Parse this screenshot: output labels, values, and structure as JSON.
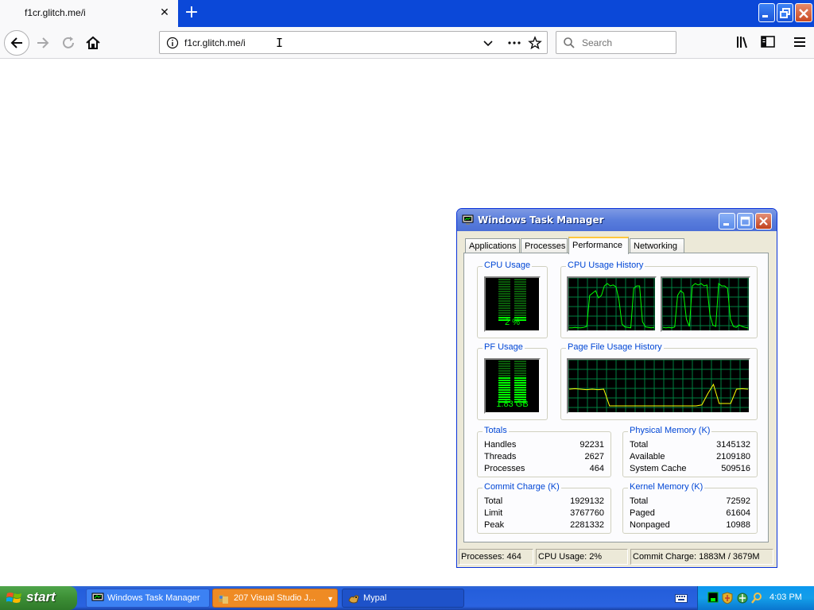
{
  "browser": {
    "tab_title": "f1cr.glitch.me/i",
    "url": "f1cr.glitch.me/i",
    "search_placeholder": "Search"
  },
  "task_manager": {
    "title": "Windows Task Manager",
    "tabs": [
      {
        "label": "Applications",
        "active": false
      },
      {
        "label": "Processes",
        "active": false
      },
      {
        "label": "Performance",
        "active": true
      },
      {
        "label": "Networking",
        "active": false
      }
    ],
    "groups": {
      "cpu_usage": "CPU Usage",
      "cpu_history": "CPU Usage History",
      "pf_usage": "PF Usage",
      "pf_history": "Page File Usage History",
      "totals": "Totals",
      "physical": "Physical Memory (K)",
      "commit": "Commit Charge (K)",
      "kernel": "Kernel Memory (K)"
    },
    "cpu_usage_value": "2 %",
    "pf_usage_value": "1.83 GB",
    "cpu_fraction": 0.02,
    "pf_fraction": 0.5,
    "totals": [
      {
        "label": "Handles",
        "value": "92231"
      },
      {
        "label": "Threads",
        "value": "2627"
      },
      {
        "label": "Processes",
        "value": "464"
      }
    ],
    "physical_memory": [
      {
        "label": "Total",
        "value": "3145132"
      },
      {
        "label": "Available",
        "value": "2109180"
      },
      {
        "label": "System Cache",
        "value": "509516"
      }
    ],
    "commit_charge": [
      {
        "label": "Total",
        "value": "1929132"
      },
      {
        "label": "Limit",
        "value": "3767760"
      },
      {
        "label": "Peak",
        "value": "2281332"
      }
    ],
    "kernel_memory": [
      {
        "label": "Total",
        "value": "72592"
      },
      {
        "label": "Paged",
        "value": "61604"
      },
      {
        "label": "Nonpaged",
        "value": "10988"
      }
    ],
    "status": {
      "processes": "Processes: 464",
      "cpu": "CPU Usage: 2%",
      "commit": "Commit Charge: 1883M / 3679M"
    }
  },
  "taskbar": {
    "start_label": "start",
    "buttons": [
      {
        "label": "Windows Task Manager"
      },
      {
        "label": "207 Visual Studio J..."
      },
      {
        "label": "Mypal"
      }
    ],
    "clock": "4:03 PM"
  },
  "colors": {
    "graph_line": "#00ff00",
    "graph_grid": "#008040",
    "pf_line": "#ffff00",
    "xp_blue": "#245edb",
    "start_green": "#3c8e35"
  }
}
